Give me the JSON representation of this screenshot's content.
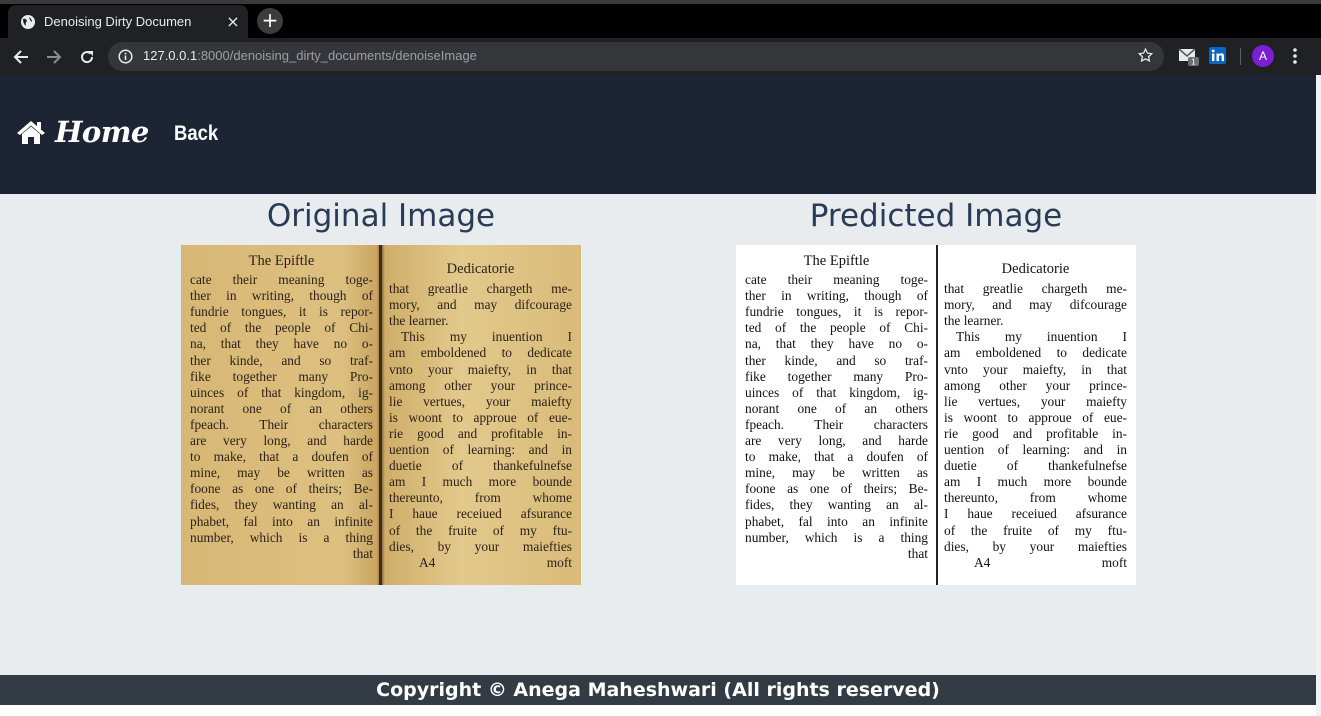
{
  "browser": {
    "tab_title": "Denoising Dirty Documen",
    "tab_close": "×",
    "new_tab": "+",
    "url_host": "127.0.0.1",
    "url_rest": ":8000/denoising_dirty_documents/denoiseImage",
    "profile_initial": "A",
    "ext_badge": "1"
  },
  "nav": {
    "brand": "Home",
    "back": "Back"
  },
  "main": {
    "original_title": "Original Image",
    "predicted_title": "Predicted Image"
  },
  "document": {
    "left_head": "The Epiftle",
    "left_lines": [
      "cate their meaning toge-",
      "ther in writing, though of",
      "fundrie tongues, it is repor-",
      "ted of the people of Chi-",
      "na, that they have no o-",
      "ther kinde, and so traf-",
      "fike together many Pro-",
      "uinces of that kingdom, ig-",
      "norant one of an others",
      "fpeach.  Their characters",
      "are very long, and harde",
      "to make, that a doufen of",
      "mine, may be written as",
      "foone as one of theirs; Be-",
      "fides, they wanting an al-",
      "phabet, fal into an infinite",
      "number, which is a thing"
    ],
    "left_end": "that",
    "right_head": "Dedicatorie",
    "right_lines": [
      "that greatlie chargeth me-",
      "mory, and may difcourage",
      "the learner.",
      "This my inuention I",
      "am emboldened to dedicate",
      "vnto your maiefty, in that",
      "among other your prince-",
      "lie vertues, your maiefty",
      "is woont to approue of eue-",
      "rie good and profitable in-",
      "uention of learning: and in",
      "duetie of thankefulnefse",
      "am I much more bounde",
      "thereunto, from whome",
      "I haue receiued afsurance",
      "of the fruite of my ftu-",
      "dies, by your maiefties"
    ],
    "right_foot_left": "A4",
    "right_foot_right": "moft"
  },
  "footer": {
    "text": "Copyright © Anega Maheshwari (All rights reserved)"
  }
}
